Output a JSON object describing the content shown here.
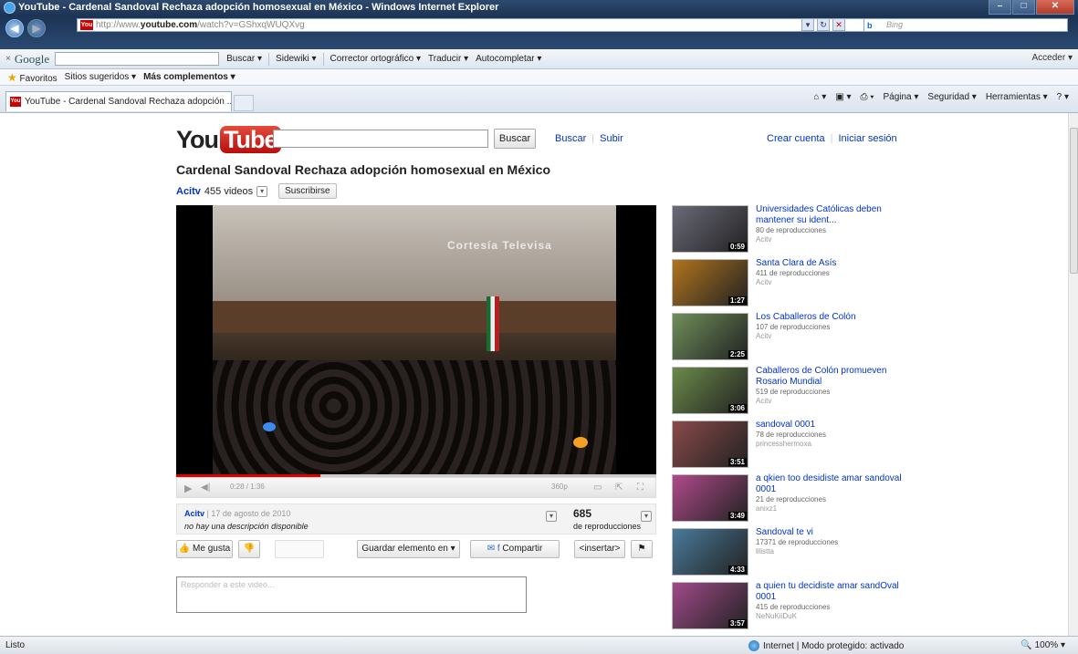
{
  "browser": {
    "title": "YouTube - Cardenal Sandoval Rechaza adopción homosexual en México - Windows Internet Explorer",
    "url_prefix": "http://www.",
    "url_domain": "youtube.com",
    "url_path": "/watch?v=GShxqWUQXvg",
    "bing_placeholder": "Bing",
    "tab_title": "YouTube - Cardenal Sandoval Rechaza adopción ...",
    "status_left": "Listo",
    "status_zone": "Internet | Modo protegido: activado",
    "zoom": "100%"
  },
  "google_toolbar": {
    "close": "×",
    "logo": "Google",
    "items": [
      "Buscar ▾",
      "Sidewiki ▾",
      "Corrector ortográfico ▾",
      "Traducir ▾",
      "Autocompletar ▾"
    ],
    "right": "Acceder ▾"
  },
  "favorites_bar": {
    "favorites": "Favoritos",
    "suggested": "Sitios sugeridos ▾",
    "more": "Más complementos ▾"
  },
  "command_bar": [
    "Página ▾",
    "Seguridad ▾",
    "Herramientas ▾"
  ],
  "youtube": {
    "logo_you": "You",
    "logo_tube": "Tube",
    "search_button": "Buscar",
    "nav": [
      "Buscar",
      "Subir"
    ],
    "account": [
      "Crear cuenta",
      "Iniciar sesión"
    ],
    "video_title": "Cardenal Sandoval Rechaza adopción homosexual en México",
    "channel": "Acitv",
    "video_count": "455 videos",
    "subscribe": "Suscribirse",
    "watermark": "Cortesía Televisa",
    "time": "0:28 / 1:36",
    "quality": "360p",
    "progress": 0.3,
    "uploader": "Acitv",
    "upload_date": "17 de agosto de 2010",
    "description": "no hay una descripción disponible",
    "views": "685",
    "views_label": "de reproducciones",
    "like": "Me gusta",
    "save": "Guardar elemento en ▾",
    "share": "Compartir",
    "embed": "<insertar>",
    "comment_placeholder": "Responder a este video..."
  },
  "related": [
    {
      "title": "Universidades Católicas deben mantener su ident...",
      "views": "80 de reproducciones",
      "author": "Acitv",
      "duration": "0:59",
      "color": "#6a6a78"
    },
    {
      "title": "Santa Clara de Asís",
      "views": "411 de reproducciones",
      "author": "Acitv",
      "duration": "1:27",
      "color": "#b0741e"
    },
    {
      "title": "Los Caballeros de Colón",
      "views": "107 de reproducciones",
      "author": "Acitv",
      "duration": "2:25",
      "color": "#6f8f5a"
    },
    {
      "title": "Caballeros de Colón promueven Rosario Mundial",
      "views": "519 de reproducciones",
      "author": "Acitv",
      "duration": "3:06",
      "color": "#6b8a4a"
    },
    {
      "title": "sandoval 0001",
      "views": "78 de reproducciones",
      "author": "princesshermoxa",
      "duration": "3:51",
      "color": "#8a4a4a"
    },
    {
      "title": "a qkien too desidiste amar sandoval 0001",
      "views": "21 de reproducciones",
      "author": "anixz1",
      "duration": "3:49",
      "color": "#b04a8a"
    },
    {
      "title": "Sandoval te vi",
      "views": "17371 de reproducciones",
      "author": "lilistta",
      "duration": "4:33",
      "color": "#4a7a9a"
    },
    {
      "title": "a quien tu decidiste amar sandOval 0001",
      "views": "415 de reproducciones",
      "author": "NeNuKiiDuK",
      "duration": "3:57",
      "color": "#a04a8a"
    }
  ]
}
